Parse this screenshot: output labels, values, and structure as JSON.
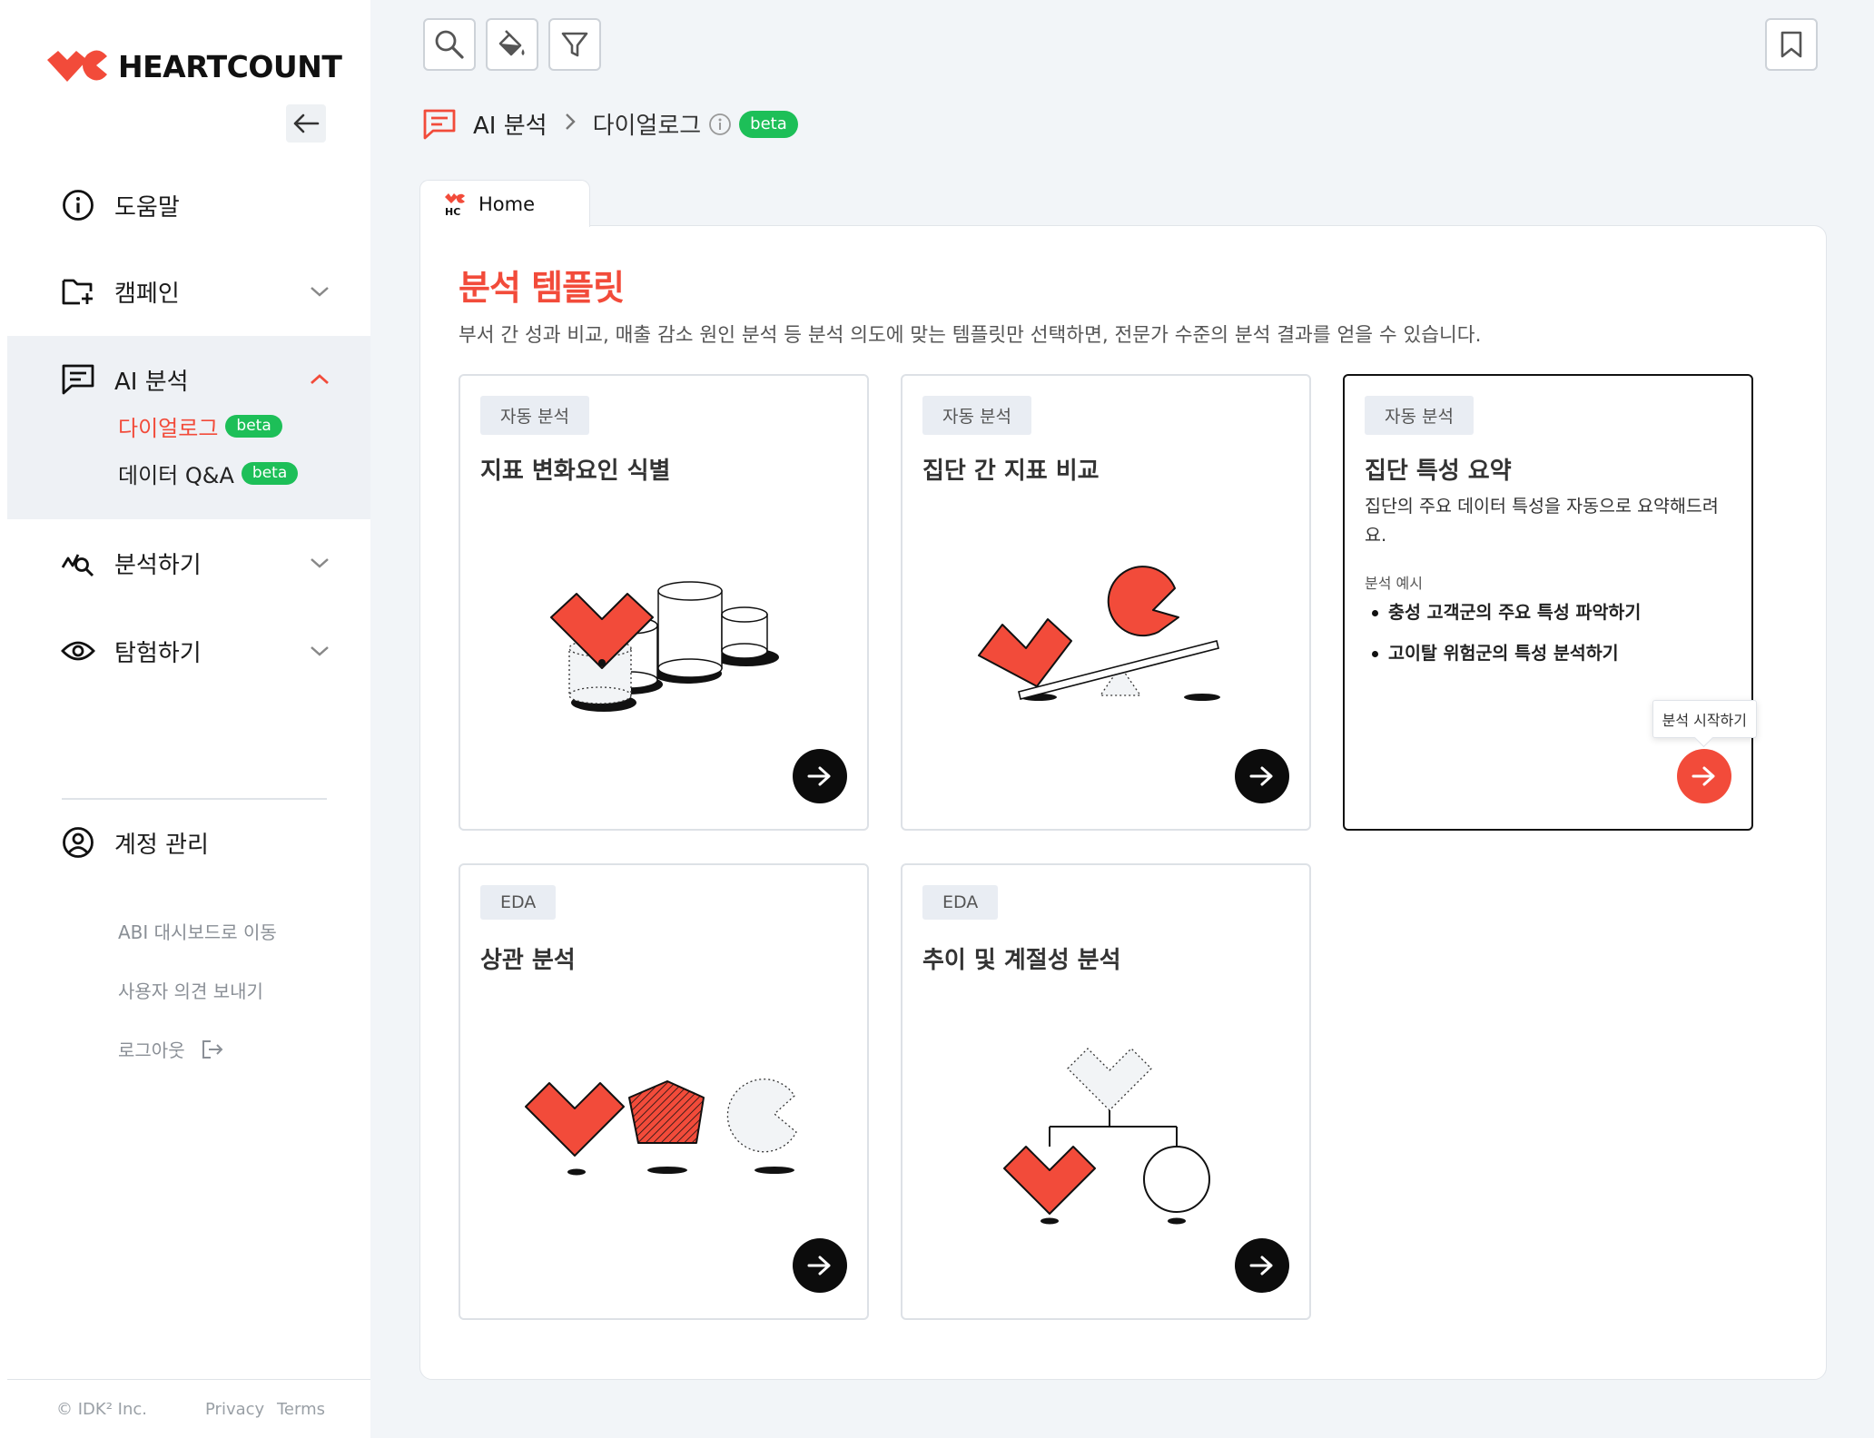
{
  "brand": {
    "name": "HEARTCOUNT",
    "accent": "#f24b3a",
    "beta_color": "#1dbf58"
  },
  "sidebar": {
    "items": [
      {
        "label": "도움말",
        "icon": "info-icon"
      },
      {
        "label": "캠페인",
        "icon": "folder-plus-icon"
      },
      {
        "label": "AI 분석",
        "icon": "chat-icon",
        "expanded": true,
        "children": [
          {
            "label": "다이얼로그",
            "badge": "beta",
            "active": true
          },
          {
            "label": "데이터 Q&A",
            "badge": "beta"
          }
        ]
      },
      {
        "label": "분석하기",
        "icon": "analyze-icon"
      },
      {
        "label": "탐험하기",
        "icon": "eye-icon"
      }
    ],
    "account": {
      "label": "계정 관리",
      "icon": "user-circle-icon"
    },
    "links": [
      "ABI 대시보드로 이동",
      "사용자 의견 보내기",
      "로그아웃"
    ],
    "footer": {
      "copyright": "© IDK² Inc.",
      "privacy": "Privacy",
      "terms": "Terms"
    }
  },
  "toolbar": {
    "icons": [
      "search-icon",
      "paint-bucket-icon",
      "filter-icon",
      "bookmark-icon"
    ]
  },
  "breadcrumb": {
    "root": "AI 분석",
    "current": "다이얼로그",
    "badge": "beta"
  },
  "tab": {
    "label": "Home"
  },
  "main": {
    "title": "분석 템플릿",
    "description": "부서 간 성과 비교, 매출 감소 원인 분석 등 분석 의도에 맞는 템플릿만 선택하면, 전문가 수준의 분석 결과를 얻을 수 있습니다.",
    "cards": [
      {
        "tag": "자동 분석",
        "title": "지표 변화요인 식별"
      },
      {
        "tag": "자동 분석",
        "title": "집단 간 지표 비교"
      },
      {
        "tag": "자동 분석",
        "title": "집단 특성 요약",
        "description": "집단의 주요 데이터 특성을 자동으로 요약해드려요.",
        "example_label": "분석 예시",
        "examples": [
          "충성 고객군의 주요 특성 파악하기",
          "고이탈 위험군의 특성 분석하기"
        ],
        "tooltip": "분석 시작하기",
        "selected": true
      },
      {
        "tag": "EDA",
        "title": "상관 분석"
      },
      {
        "tag": "EDA",
        "title": "추이 및 계절성 분석"
      }
    ]
  }
}
